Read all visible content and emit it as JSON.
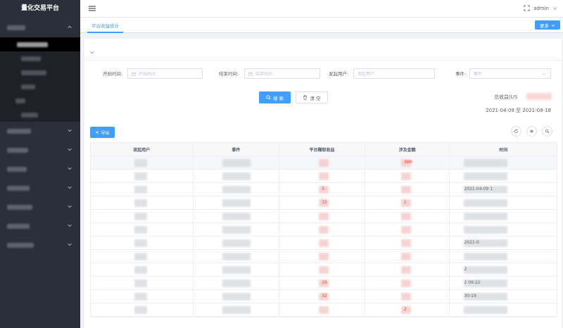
{
  "app_title": "量化交易平台",
  "header": {
    "user": "admin"
  },
  "tabs": {
    "active": "平台收益统计",
    "more_label": "更多"
  },
  "filters": {
    "start_label": "开始时间:",
    "start_placeholder": "开始时间",
    "end_label": "结束时间:",
    "end_placeholder": "结束时间",
    "user_label": "发起用户:",
    "user_placeholder": "发起用户",
    "event_label": "事件:",
    "event_placeholder": "事件"
  },
  "buttons": {
    "search": "搜 索",
    "clear": "清 空",
    "export": "导出"
  },
  "summary": {
    "total_label": "总收益(US",
    "date_range": "2021-04-09 至 2021-08-18"
  },
  "table": {
    "columns": [
      "发起用户",
      "事件",
      "平台赚取收益",
      "涉及金额",
      "时间"
    ],
    "rows": [
      [
        "",
        "",
        "",
        "300",
        ""
      ],
      [
        "",
        "",
        "",
        "",
        ""
      ],
      [
        "",
        "",
        "5",
        "",
        "2021-04-09 1"
      ],
      [
        "",
        "",
        "15",
        "1",
        ""
      ],
      [
        "",
        "",
        "",
        "",
        ""
      ],
      [
        "",
        "",
        "",
        "",
        ""
      ],
      [
        "",
        "",
        "",
        "",
        "2021-0"
      ],
      [
        "",
        "",
        "",
        "",
        ""
      ],
      [
        "",
        "",
        "",
        "",
        "2"
      ],
      [
        "",
        "",
        "29",
        "",
        "2 09:22"
      ],
      [
        "",
        "",
        "32",
        "",
        "30:19"
      ],
      [
        "",
        "",
        "",
        "2",
        ""
      ]
    ]
  },
  "colors": {
    "primary": "#409eff",
    "sidebar": "#2b2f3a",
    "value_red": "#e74c3c"
  }
}
